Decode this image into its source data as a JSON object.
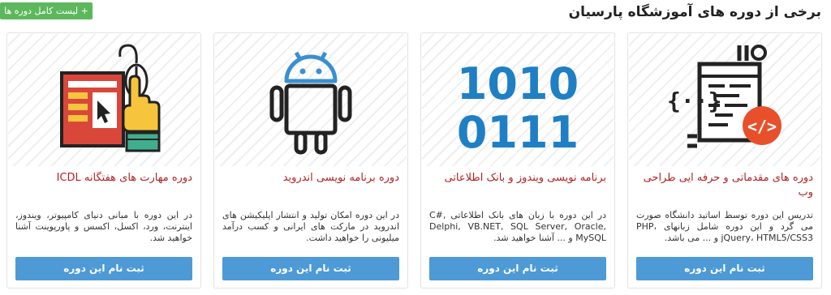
{
  "header": {
    "title": "برخی از دوره های آموزشگاه پارسیان",
    "list_button": "+ لیست کامل دوره ها"
  },
  "cards": [
    {
      "title": "دوره های مقدماتی و حرفه ایی طراحی وب",
      "description": "تدریس این دوره توسط اساتید دانشگاه صورت می گرد و این دوره شامل زبانهای PHP، jQuery، HTML5/CSS3 و ... می باشد.",
      "button": "ثبت نام این دوره",
      "icon": "web-design-icon"
    },
    {
      "title": "برنامه نویسی ویندوز و بانک اطلاعاتی",
      "description": "در این دوره با زبان های بانک اطلاعاتی C#, Delphi, VB.NET, SQL Server, Oracle, MySQL و ... آشنا خواهید شد.",
      "button": "ثبت نام این دوره",
      "icon": "binary-code-icon",
      "binary_line1": "1010",
      "binary_line2": "0111"
    },
    {
      "title": "دوره برنامه نویسی اندروید",
      "description": "در این دوره امکان تولید و انتشار اپلیکیشن های اندروید در مارکت های ایرانی و کسب درآمد میلیونی را خواهید داشت.",
      "button": "ثبت نام این دوره",
      "icon": "android-icon"
    },
    {
      "title": "دوره مهارت های هفتگانه ICDL",
      "description": "در این دوره با مبانی دنیای کامپیوتر، ویندوز، اینترنت، ورد، اکسل، اکسس و پاورپوینت آشنا خواهید شد.",
      "button": "ثبت نام این دوره",
      "icon": "computer-mouse-icon"
    }
  ],
  "colors": {
    "accent_blue": "#4d9ad6",
    "title_red": "#b22222",
    "list_green": "#5cb85c",
    "icon_orange": "#e8502c",
    "binary_blue": "#1f7fc4"
  }
}
